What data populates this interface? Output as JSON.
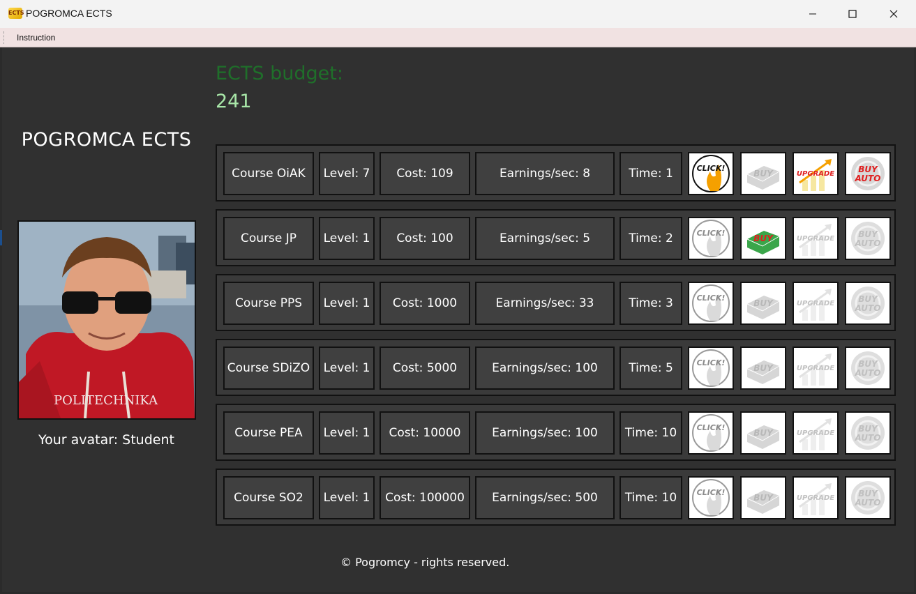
{
  "window": {
    "title": "POGROMCA ECTS",
    "icon": "ects-app-icon",
    "controls": [
      "minimize-icon",
      "maximize-icon",
      "close-icon"
    ]
  },
  "menu": {
    "instruction": "Instruction"
  },
  "budget": {
    "label": "ECTS budget:",
    "value": "241"
  },
  "sidebar": {
    "title": "POGROMCA ECTS",
    "avatar_caption": "Your avatar: Student"
  },
  "courses": [
    {
      "name": "Course OiAK",
      "level": "Level: 7",
      "cost": "Cost: 109",
      "earnings": "Earnings/sec: 8",
      "time": "Time: 1",
      "click_active": true,
      "buy_active": false,
      "upgrade_active": true,
      "buyauto_active": true
    },
    {
      "name": "Course JP",
      "level": "Level: 1",
      "cost": "Cost: 100",
      "earnings": "Earnings/sec: 5",
      "time": "Time: 2",
      "click_active": false,
      "buy_active": true,
      "upgrade_active": false,
      "buyauto_active": false
    },
    {
      "name": "Course PPS",
      "level": "Level: 1",
      "cost": "Cost: 1000",
      "earnings": "Earnings/sec: 33",
      "time": "Time: 3",
      "click_active": false,
      "buy_active": false,
      "upgrade_active": false,
      "buyauto_active": false
    },
    {
      "name": "Course SDiZO",
      "level": "Level: 1",
      "cost": "Cost: 5000",
      "earnings": "Earnings/sec: 100",
      "time": "Time: 5",
      "click_active": false,
      "buy_active": false,
      "upgrade_active": false,
      "buyauto_active": false
    },
    {
      "name": "Course PEA",
      "level": "Level: 1",
      "cost": "Cost: 10000",
      "earnings": "Earnings/sec: 100",
      "time": "Time: 10",
      "click_active": false,
      "buy_active": false,
      "upgrade_active": false,
      "buyauto_active": false
    },
    {
      "name": "Course SO2",
      "level": "Level: 1",
      "cost": "Cost: 100000",
      "earnings": "Earnings/sec: 500",
      "time": "Time: 10",
      "click_active": false,
      "buy_active": false,
      "upgrade_active": false,
      "buyauto_active": false
    }
  ],
  "buttons": {
    "click": "CLICK!",
    "buy": "BUY",
    "upgrade": "UPGRADE",
    "buyauto_top": "BUY",
    "buyauto_bottom": "AUTO"
  },
  "colors": {
    "background": "#303030",
    "budget_label": "#1f6f2a",
    "budget_value": "#a8e6a8",
    "accent_red": "#e02020",
    "accent_orange": "#f5a000",
    "buy_green": "#3aa64a",
    "inactive_gray": "#c8c8c8"
  },
  "footer": "© Pogromcy - rights reserved."
}
